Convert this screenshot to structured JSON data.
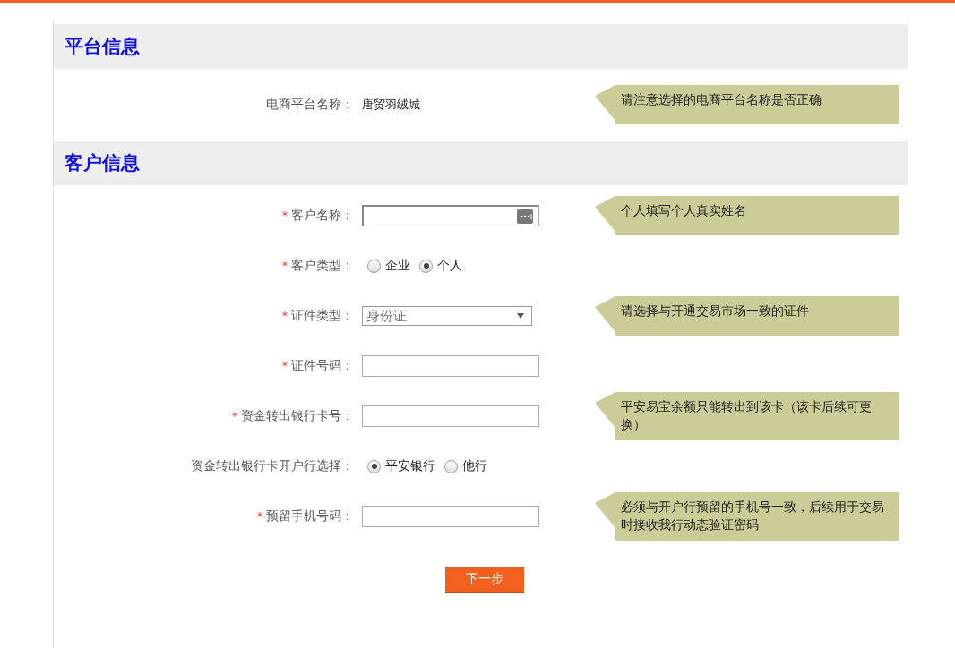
{
  "sections": [
    {
      "title": "平台信息",
      "rows": [
        {
          "kind": "text",
          "label": "电商平台名称：",
          "value": "唐贸羽绒城",
          "tip": "请注意选择的电商平台名称是否正确"
        }
      ]
    },
    {
      "title": "客户信息",
      "rows": [
        {
          "kind": "keypad_input",
          "mark": "*",
          "label": "客户名称：",
          "value": "",
          "tip": "个人填写个人真实姓名"
        },
        {
          "kind": "radio",
          "mark": "*",
          "label": "客户类型：",
          "options": [
            {
              "label": "企业",
              "selected": false
            },
            {
              "label": "个人",
              "selected": true
            }
          ]
        },
        {
          "kind": "select",
          "mark": "*",
          "label": "证件类型：",
          "value": "身份证",
          "tip": "请选择与开通交易市场一致的证件"
        },
        {
          "kind": "input",
          "mark": "*",
          "label": "证件号码：",
          "value": ""
        },
        {
          "kind": "input",
          "mark": "*",
          "label": "资金转出银行卡号：",
          "value": "",
          "tip": "平安易宝余额只能转出到该卡（该卡后续可更换）"
        },
        {
          "kind": "radio",
          "label": "资金转出银行卡开户行选择：",
          "options": [
            {
              "label": "平安银行",
              "selected": true
            },
            {
              "label": "他行",
              "selected": false
            }
          ]
        },
        {
          "kind": "input",
          "mark": "*",
          "label": "预留手机号码：",
          "value": "",
          "tip": "必须与开户行预留的手机号一致，后续用于交易时接收我行动态验证密码"
        }
      ]
    }
  ],
  "submit": "下一步"
}
